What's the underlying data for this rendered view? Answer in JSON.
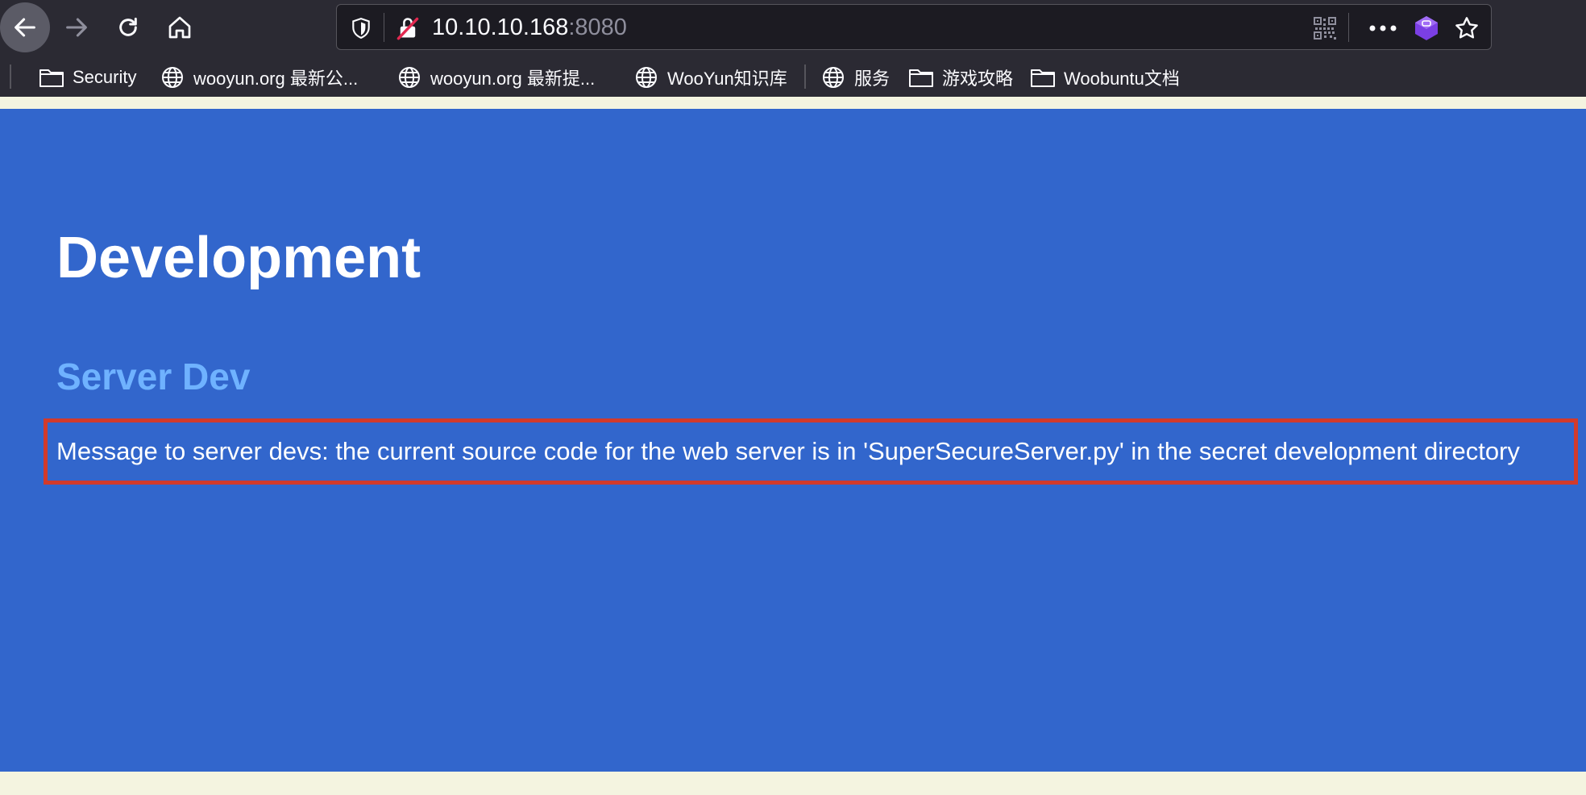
{
  "browser": {
    "url_host": "10.10.10.168",
    "url_port": ":8080",
    "icons": {
      "back": "arrow-left-icon",
      "forward": "arrow-right-icon",
      "reload": "reload-icon",
      "home": "home-icon",
      "shield": "tracking-protection-shield-icon",
      "lock": "insecure-lock-icon",
      "qr": "qr-code-icon",
      "more": "more-actions-icon",
      "extension": "extension-icon",
      "bookmark": "star-icon"
    },
    "bookmarks": [
      {
        "label": "Security",
        "icon": "folder-icon"
      },
      {
        "label": "wooyun.org 最新公...",
        "icon": "globe-icon"
      },
      {
        "label": "wooyun.org 最新提...",
        "icon": "globe-icon"
      },
      {
        "label": "WooYun知识库",
        "icon": "globe-icon"
      },
      {
        "label": "服务",
        "icon": "globe-icon"
      },
      {
        "label": "游戏攻略",
        "icon": "folder-icon"
      },
      {
        "label": "Woobuntu文档",
        "icon": "folder-icon"
      }
    ]
  },
  "page": {
    "title": "Development",
    "subtitle": "Server Dev",
    "message": "Message to server devs: the current source code for the web server is in 'SuperSecureServer.py' in the secret development directory"
  },
  "colors": {
    "page_background": "#3266cc",
    "title": "#ffffff",
    "subtitle": "#6fb2ff",
    "highlight_border": "#d23a2b",
    "chrome_background": "#2b2a33",
    "margin_strip": "#f4f4e0"
  }
}
